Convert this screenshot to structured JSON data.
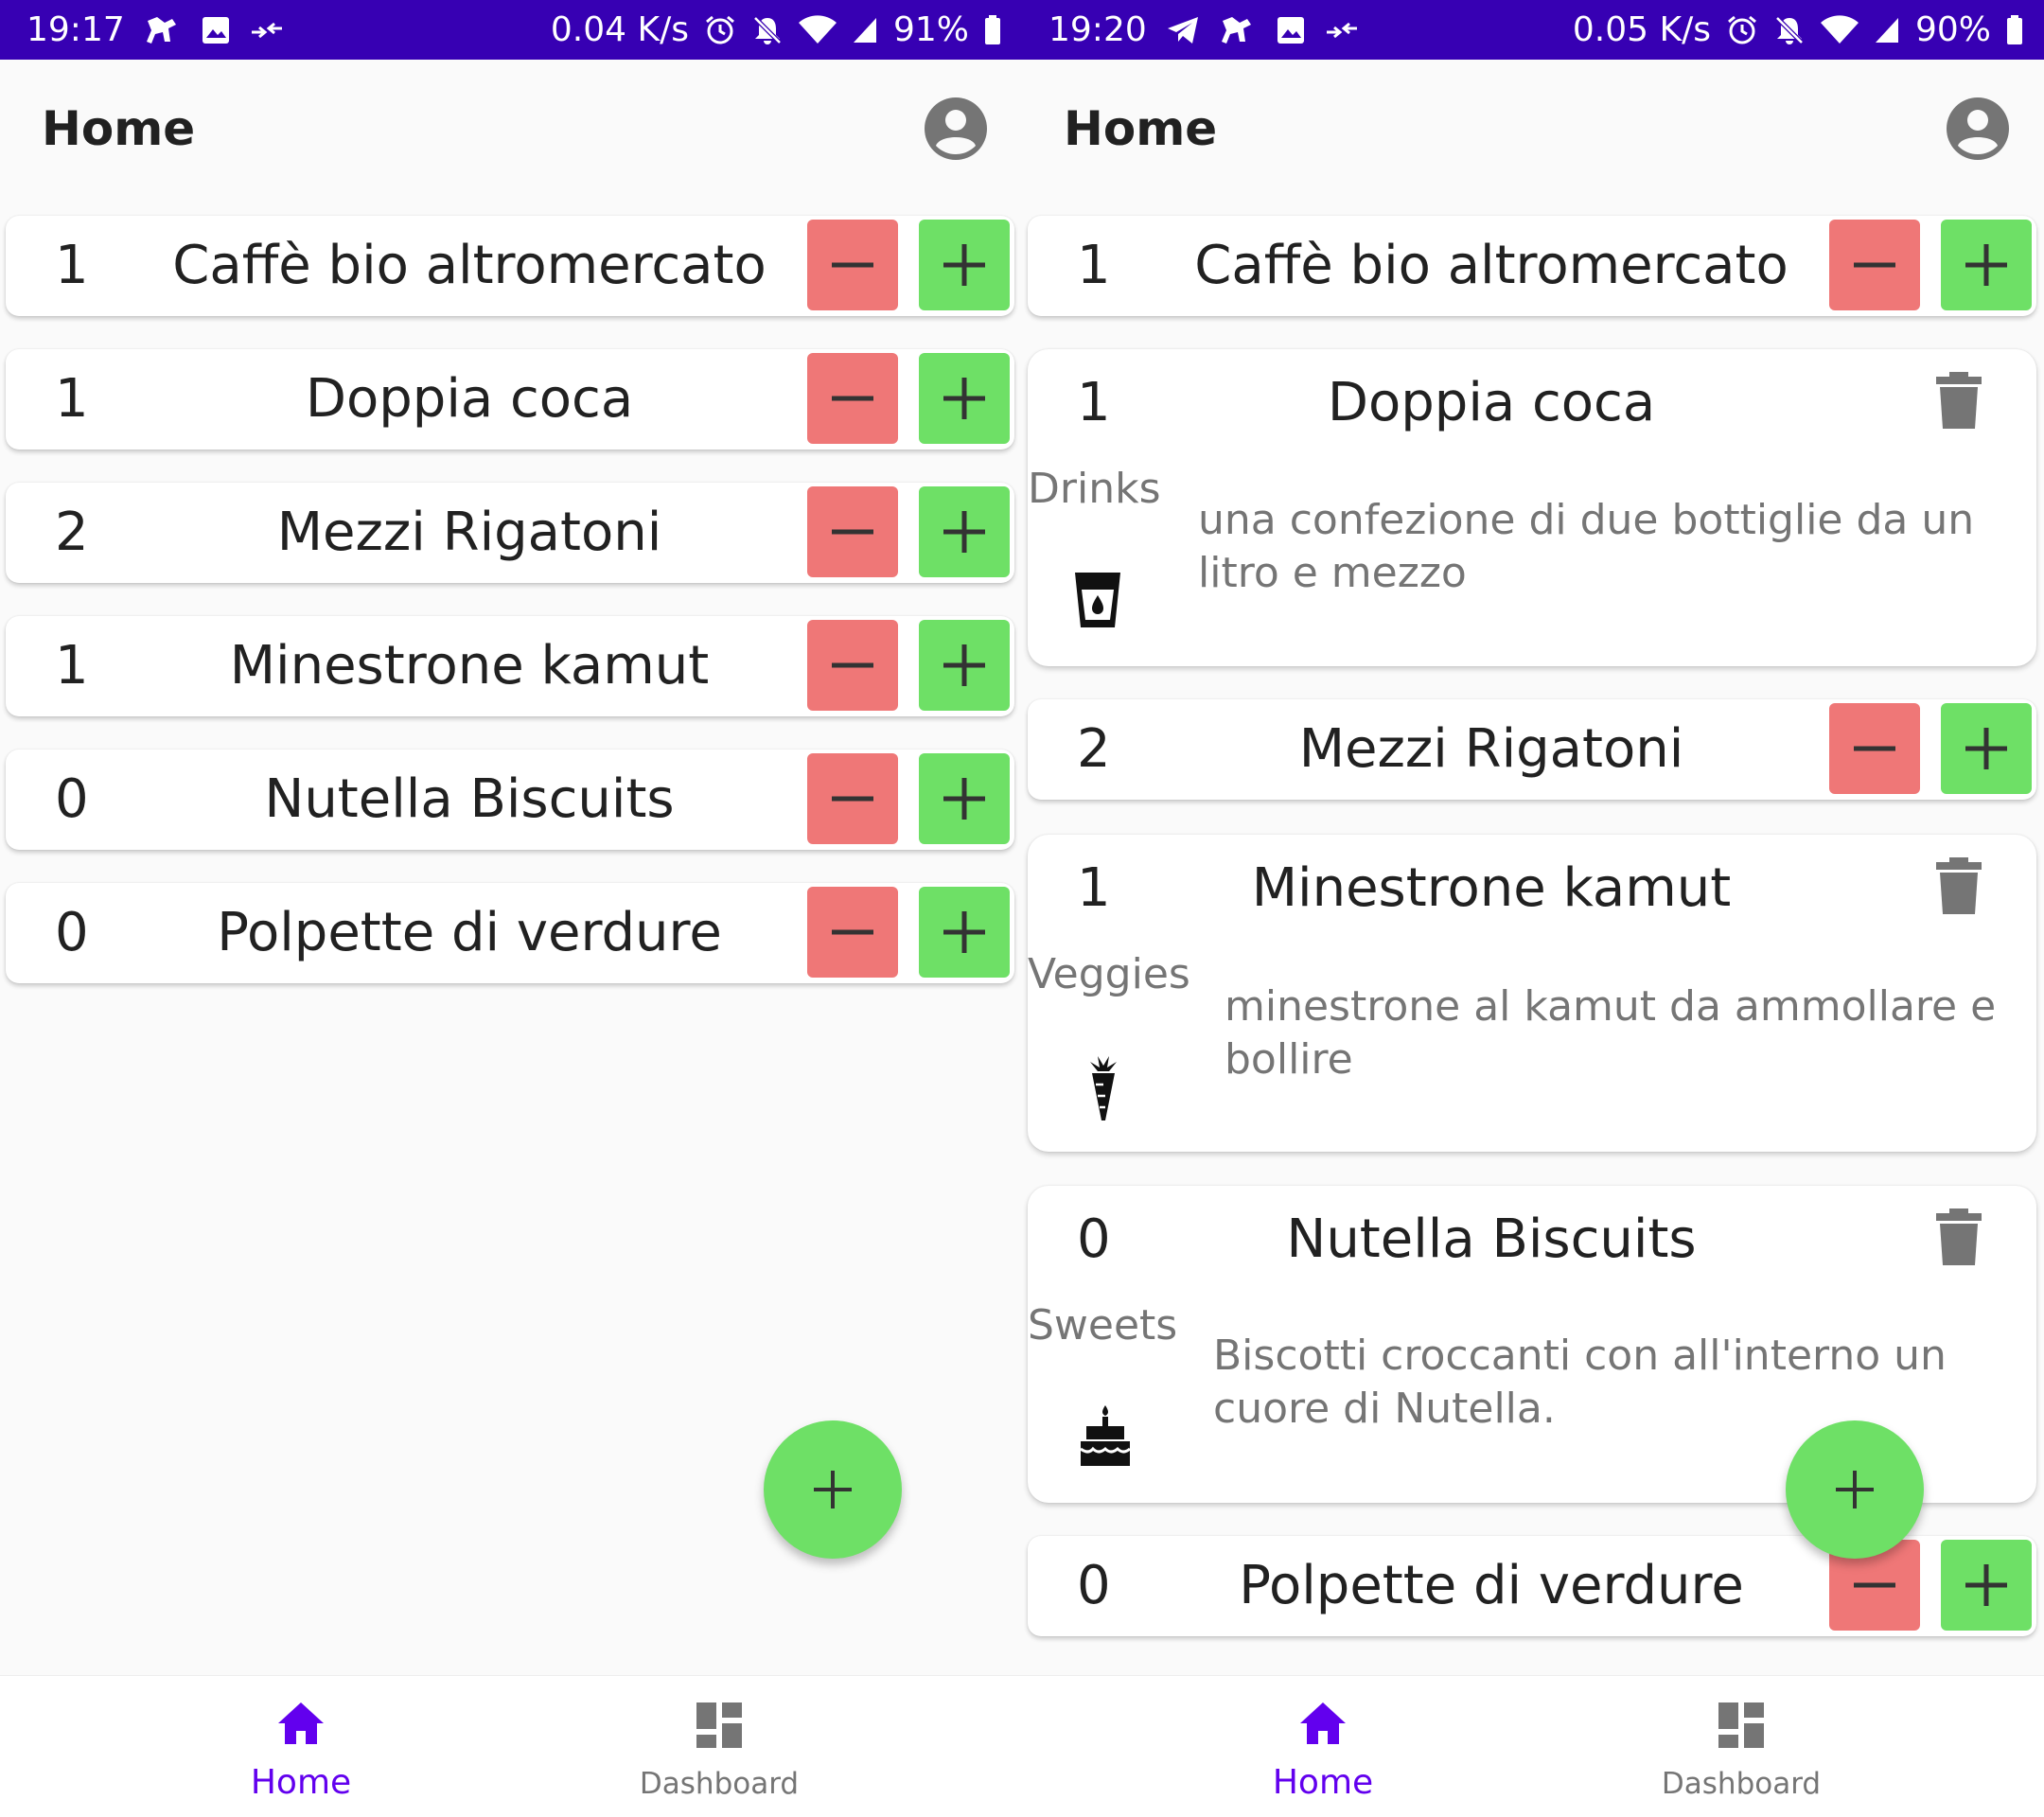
{
  "screens": [
    {
      "status": {
        "time": "19:17",
        "speed": "0.04 K/s",
        "battery": "91%"
      },
      "title": "Home",
      "items": [
        {
          "qty": "1",
          "name": "Caffè bio altromercato"
        },
        {
          "qty": "1",
          "name": "Doppia coca"
        },
        {
          "qty": "2",
          "name": "Mezzi Rigatoni"
        },
        {
          "qty": "1",
          "name": "Minestrone kamut"
        },
        {
          "qty": "0",
          "name": "Nutella Biscuits"
        },
        {
          "qty": "0",
          "name": "Polpette di verdure"
        }
      ],
      "nav": {
        "home": "Home",
        "dashboard": "Dashboard"
      }
    },
    {
      "status": {
        "time": "19:20",
        "speed": "0.05 K/s",
        "battery": "90%"
      },
      "title": "Home",
      "items": [
        {
          "qty": "1",
          "name": "Caffè bio altromercato"
        },
        {
          "qty": "1",
          "name": "Doppia coca",
          "category": "Drinks",
          "category_icon": "drink-icon",
          "description": "una confezione di due bottiglie da un litro e mezzo"
        },
        {
          "qty": "2",
          "name": "Mezzi Rigatoni"
        },
        {
          "qty": "1",
          "name": "Minestrone kamut",
          "category": "Veggies",
          "category_icon": "carrot-icon",
          "description": "minestrone al kamut da ammollare e bollire"
        },
        {
          "qty": "0",
          "name": "Nutella Biscuits",
          "category": "Sweets",
          "category_icon": "cake-icon",
          "description": "Biscotti croccanti con all'interno un cuore di Nutella."
        },
        {
          "qty": "0",
          "name": "Polpette di verdure"
        }
      ],
      "nav": {
        "home": "Home",
        "dashboard": "Dashboard"
      }
    }
  ],
  "colors": {
    "status_bar": "#3700b3",
    "minus": "#ef7777",
    "plus": "#6ee066",
    "nav_active": "#6200ee",
    "nav_inactive": "#757575"
  }
}
